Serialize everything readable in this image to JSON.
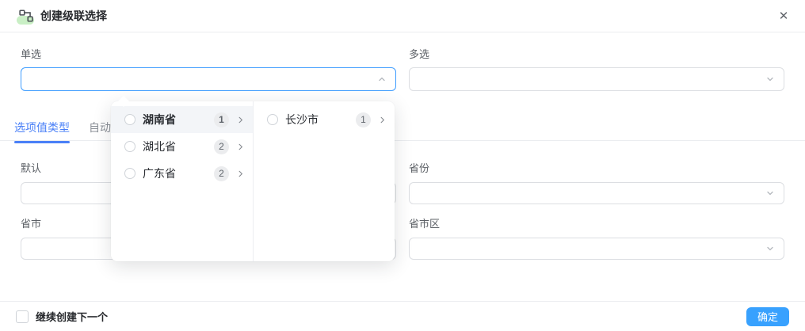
{
  "header": {
    "title": "创建级联选择"
  },
  "icons": {
    "close": "✕"
  },
  "fields": {
    "single": {
      "label": "单选",
      "value": ""
    },
    "multi": {
      "label": "多选",
      "value": ""
    },
    "default": {
      "label": "默认",
      "value": ""
    },
    "province": {
      "label": "省份",
      "value": ""
    },
    "province_city": {
      "label": "省市",
      "value": ""
    },
    "province_city_district": {
      "label": "省市区",
      "value": ""
    }
  },
  "tabs": [
    {
      "label": "选项值类型",
      "active": true
    },
    {
      "label": "自动",
      "active": false
    }
  ],
  "dropdown": {
    "columns": [
      {
        "items": [
          {
            "label": "湖南省",
            "count": "1",
            "selected": true
          },
          {
            "label": "湖北省",
            "count": "2",
            "selected": false
          },
          {
            "label": "广东省",
            "count": "2",
            "selected": false
          }
        ]
      },
      {
        "items": [
          {
            "label": "长沙市",
            "count": "1",
            "selected": false
          }
        ]
      }
    ]
  },
  "footer": {
    "checkbox_label": "继续创建下一个",
    "confirm_label": "确定"
  },
  "colors": {
    "accent_blue": "#38a1fe",
    "focus_border": "#3f9dff",
    "tab_blue": "#4a80f7",
    "icon_green": "#c9efc5",
    "badge_bg": "#ebecee",
    "row_highlight": "#f3f5f8"
  }
}
